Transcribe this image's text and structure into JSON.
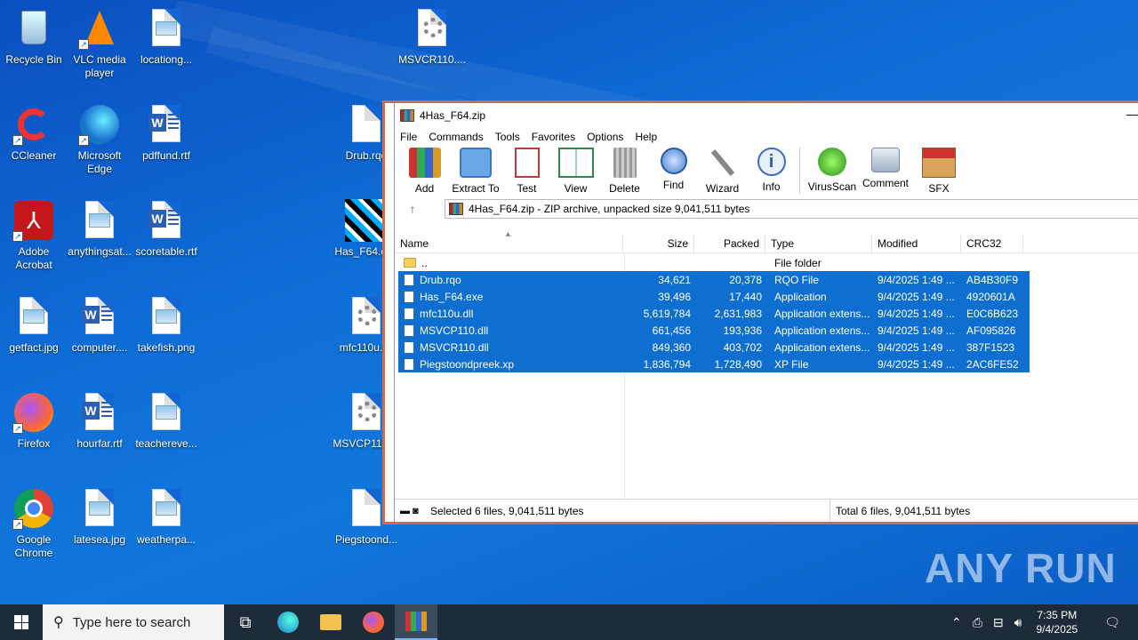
{
  "desktop": {
    "icons": [
      {
        "label": "Recycle Bin"
      },
      {
        "label": "VLC media player"
      },
      {
        "label": "locationg..."
      },
      {
        "label": "MSVCR110...."
      },
      {
        "label": "CCleaner"
      },
      {
        "label": "Microsoft Edge"
      },
      {
        "label": "pdffund.rtf"
      },
      {
        "label": "Drub.rqo"
      },
      {
        "label": "Adobe Acrobat"
      },
      {
        "label": "anythingsat..."
      },
      {
        "label": "scoretable.rtf"
      },
      {
        "label": "Has_F64.exe"
      },
      {
        "label": "getfact.jpg"
      },
      {
        "label": "computer...."
      },
      {
        "label": "takefish.png"
      },
      {
        "label": "mfc110u.dll"
      },
      {
        "label": "Firefox"
      },
      {
        "label": "hourfar.rtf"
      },
      {
        "label": "teachereve..."
      },
      {
        "label": "MSVCP110...."
      },
      {
        "label": "Google Chrome"
      },
      {
        "label": "latesea.jpg"
      },
      {
        "label": "weatherpa..."
      },
      {
        "label": "Piegstoond..."
      }
    ]
  },
  "window": {
    "title": "4Has_F64.zip",
    "menu": [
      "File",
      "Commands",
      "Tools",
      "Favorites",
      "Options",
      "Help"
    ],
    "toolbar": [
      "Add",
      "Extract To",
      "Test",
      "View",
      "Delete",
      "Find",
      "Wizard",
      "Info",
      "VirusScan",
      "Comment",
      "SFX"
    ],
    "address": "4Has_F64.zip - ZIP archive, unpacked size 9,041,511 bytes",
    "columns": {
      "name": "Name",
      "size": "Size",
      "packed": "Packed",
      "type": "Type",
      "modified": "Modified",
      "crc": "CRC32"
    },
    "parent": {
      "name": "..",
      "type": "File folder"
    },
    "files": [
      {
        "name": "Drub.rqo",
        "size": "34,621",
        "packed": "20,378",
        "type": "RQO File",
        "modified": "9/4/2025 1:49 ...",
        "crc": "AB4B30F9"
      },
      {
        "name": "Has_F64.exe",
        "size": "39,496",
        "packed": "17,440",
        "type": "Application",
        "modified": "9/4/2025 1:49 ...",
        "crc": "4920601A"
      },
      {
        "name": "mfc110u.dll",
        "size": "5,619,784",
        "packed": "2,631,983",
        "type": "Application extens...",
        "modified": "9/4/2025 1:49 ...",
        "crc": "E0C6B623"
      },
      {
        "name": "MSVCP110.dll",
        "size": "661,456",
        "packed": "193,936",
        "type": "Application extens...",
        "modified": "9/4/2025 1:49 ...",
        "crc": "AF095826"
      },
      {
        "name": "MSVCR110.dll",
        "size": "849,360",
        "packed": "403,702",
        "type": "Application extens...",
        "modified": "9/4/2025 1:49 ...",
        "crc": "387F1523"
      },
      {
        "name": "Piegstoondpreek.xp",
        "size": "1,836,794",
        "packed": "1,728,490",
        "type": "XP File",
        "modified": "9/4/2025 1:49 ...",
        "crc": "2AC6FE52"
      }
    ],
    "status_left": "Selected 6 files, 9,041,511 bytes",
    "status_right": "Total 6 files, 9,041,511 bytes"
  },
  "taskbar": {
    "search_placeholder": "Type here to search",
    "time": "7:35 PM",
    "date": "9/4/2025"
  },
  "watermark": "ANY RUN"
}
